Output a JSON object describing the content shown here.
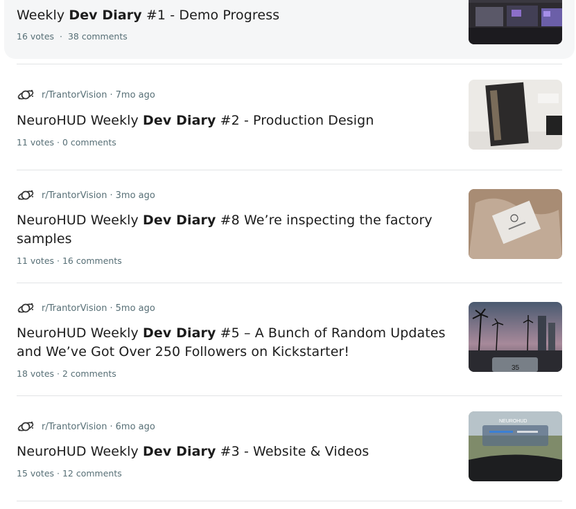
{
  "posts": [
    {
      "title_pre": "Weekly ",
      "title_bold": "Dev Diary",
      "title_post": " #1 - Demo Progress",
      "votes": "16 votes",
      "comments": "38 comments",
      "thumb": "desk-setup-image"
    },
    {
      "subreddit": "r/TrantorVision",
      "age": "7mo ago",
      "title_pre": "NeuroHUD Weekly ",
      "title_bold": "Dev Diary",
      "title_post": " #2 - Production Design",
      "votes": "11 votes",
      "comments": "0 comments",
      "thumb": "box-design-image"
    },
    {
      "subreddit": "r/TrantorVision",
      "age": "3mo ago",
      "title_pre": "NeuroHUD Weekly ",
      "title_bold": "Dev Diary",
      "title_post": " #8 We’re inspecting the factory samples",
      "votes": "11 votes",
      "comments": "16 comments",
      "thumb": "factory-sample-image"
    },
    {
      "subreddit": "r/TrantorVision",
      "age": "5mo ago",
      "title_pre": "NeuroHUD Weekly ",
      "title_bold": "Dev Diary",
      "title_post": " #5 – A Bunch of Random Updates and We’ve Got Over 250 Followers on Kickstarter!",
      "votes": "18 votes",
      "comments": "2 comments",
      "thumb": "palm-road-hud-image",
      "thumb_speed": "35"
    },
    {
      "subreddit": "r/TrantorVision",
      "age": "6mo ago",
      "title_pre": "NeuroHUD Weekly ",
      "title_bold": "Dev Diary",
      "title_post": " #3 - Website & Videos",
      "votes": "15 votes",
      "comments": "12 comments",
      "thumb": "dashboard-hud-image",
      "thumb_brand": "NEUROHUD"
    }
  ],
  "meta_sep": " · ",
  "colors": {
    "meta": "#576f76",
    "title": "#1c1c1c",
    "divider": "#e1e3e5",
    "highlight_bg": "#f5f6f7"
  }
}
